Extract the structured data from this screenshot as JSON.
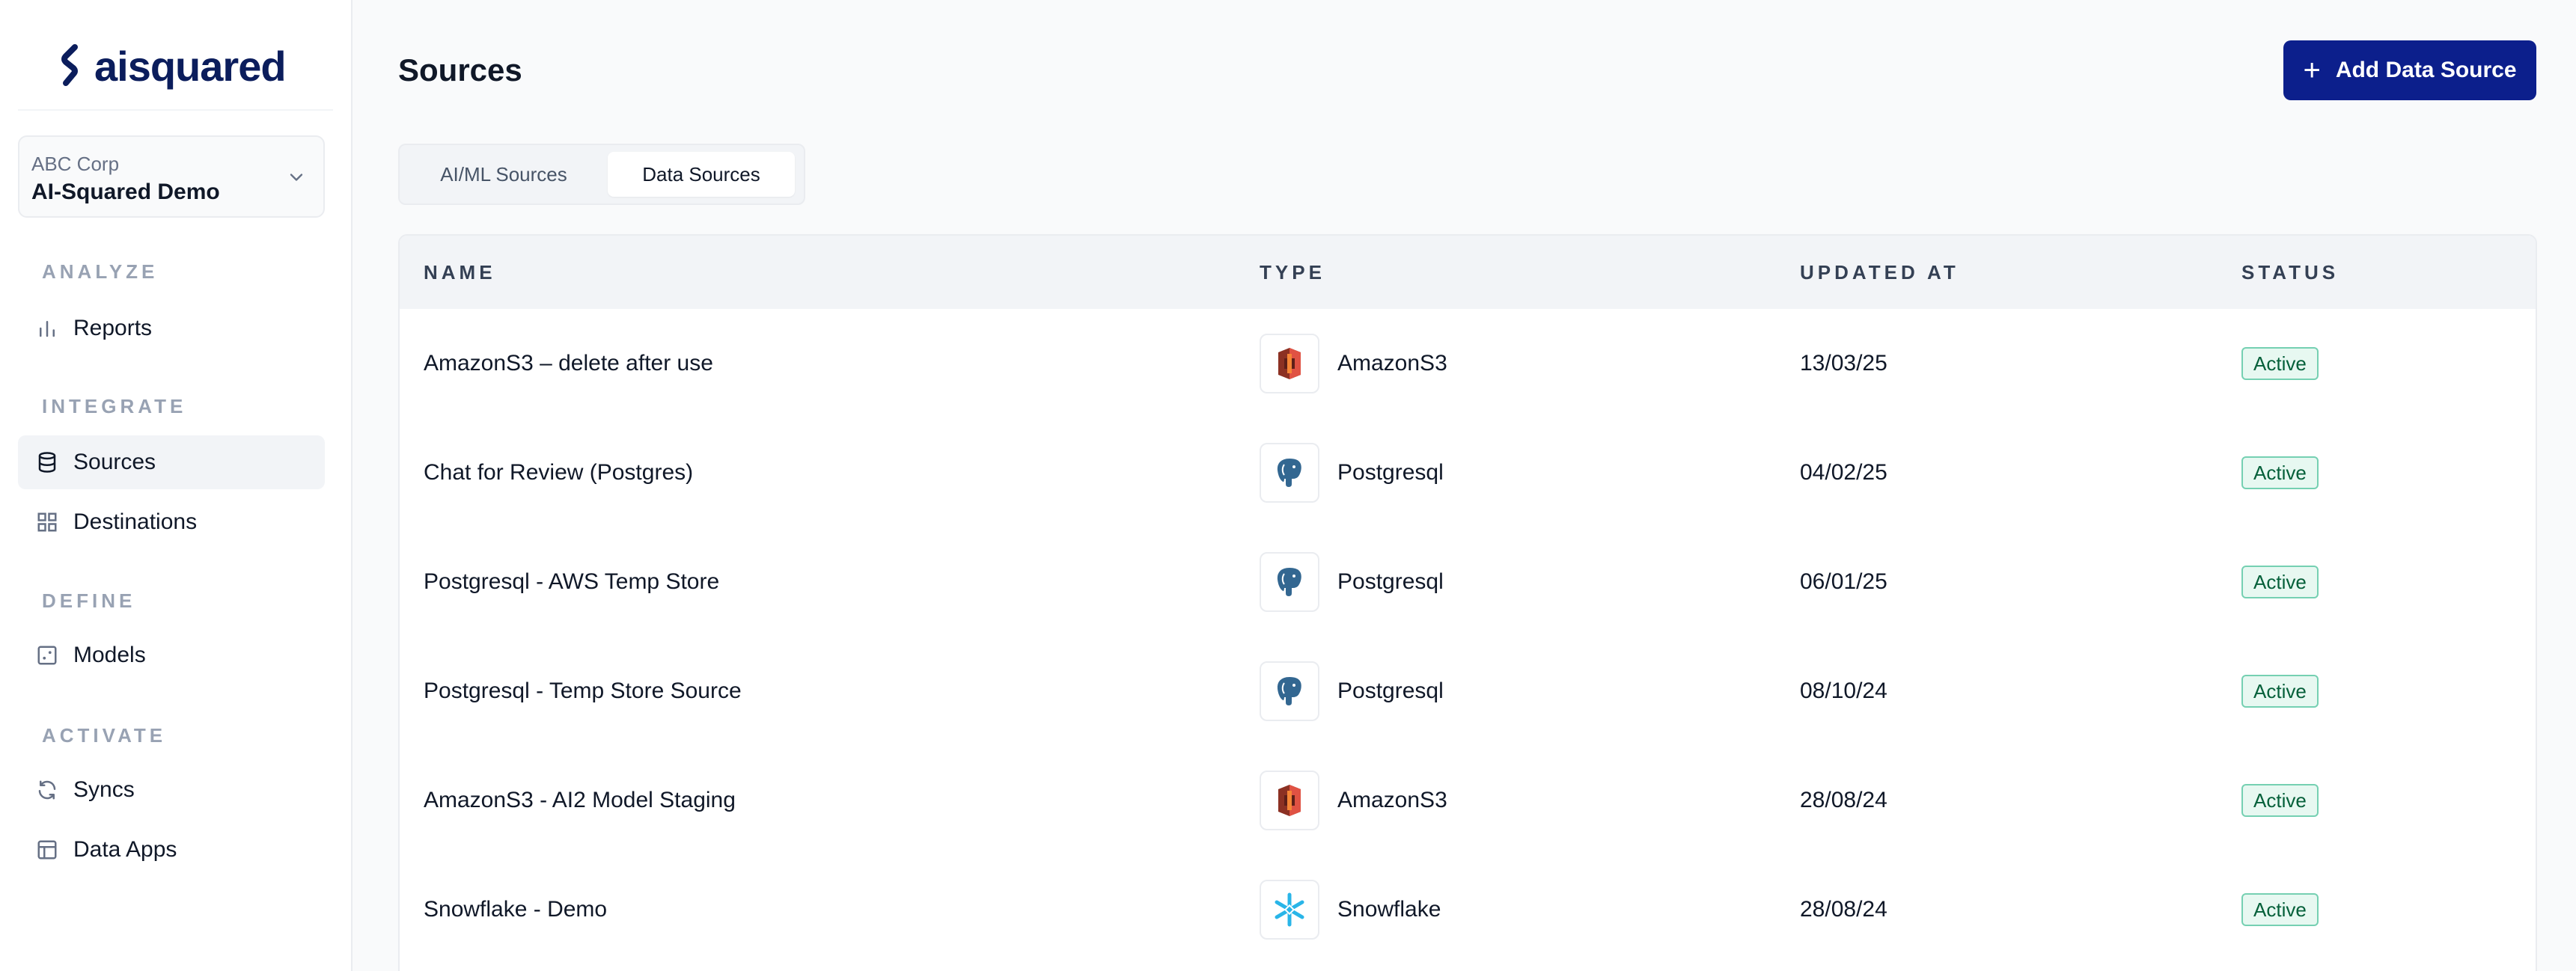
{
  "brand": {
    "logo_text": "aisquared"
  },
  "workspace": {
    "org": "ABC Corp",
    "name": "AI-Squared Demo"
  },
  "nav": {
    "analyze": "ANALYZE",
    "integrate": "INTEGRATE",
    "define": "DEFINE",
    "activate": "ACTIVATE",
    "reports": "Reports",
    "sources": "Sources",
    "destinations": "Destinations",
    "models": "Models",
    "syncs": "Syncs",
    "data_apps": "Data Apps"
  },
  "page": {
    "title": "Sources",
    "add_button": "Add Data Source",
    "tabs": [
      "AI/ML Sources",
      "Data Sources"
    ],
    "active_tab": "Data Sources"
  },
  "table": {
    "headers": {
      "name": "NAME",
      "type": "TYPE",
      "updated_at": "UPDATED AT",
      "status": "STATUS"
    },
    "rows": [
      {
        "name": "AmazonS3 – delete after use",
        "type": "AmazonS3",
        "icon": "amazons3-icon",
        "updated_at": "13/03/25",
        "status": "Active"
      },
      {
        "name": "Chat for Review (Postgres)",
        "type": "Postgresql",
        "icon": "postgresql-icon",
        "updated_at": "04/02/25",
        "status": "Active"
      },
      {
        "name": "Postgresql - AWS Temp Store",
        "type": "Postgresql",
        "icon": "postgresql-icon",
        "updated_at": "06/01/25",
        "status": "Active"
      },
      {
        "name": "Postgresql - Temp Store Source",
        "type": "Postgresql",
        "icon": "postgresql-icon",
        "updated_at": "08/10/24",
        "status": "Active"
      },
      {
        "name": "AmazonS3 - AI2 Model Staging",
        "type": "AmazonS3",
        "icon": "amazons3-icon",
        "updated_at": "28/08/24",
        "status": "Active"
      },
      {
        "name": "Snowflake - Demo",
        "type": "Snowflake",
        "icon": "snowflake-icon",
        "updated_at": "28/08/24",
        "status": "Active"
      }
    ]
  },
  "colors": {
    "primary": "#0c1f8c",
    "badge_bg": "#e7f8f1",
    "badge_border": "#75d0b2",
    "badge_text": "#05603a"
  }
}
